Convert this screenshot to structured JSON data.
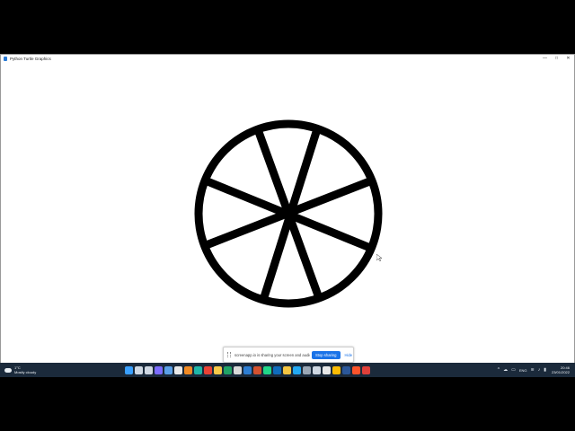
{
  "window": {
    "title": "Python Turtle Graphics",
    "controls": {
      "minimize": "—",
      "maximize": "□",
      "close": "✕"
    }
  },
  "drawing": {
    "description_shape": "circle with 4 thick spokes through center",
    "stroke_color": "#000000",
    "background": "#ffffff"
  },
  "share_bar": {
    "message": "screenapp.io is sharing your screen and audio.",
    "stop_label": "Stop sharing",
    "hide_label": "Hide"
  },
  "taskbar": {
    "weather": {
      "temp": "1°C",
      "condition": "Mostly cloudy",
      "icon": "cloud-icon"
    },
    "apps": [
      {
        "name": "windows-start-icon",
        "color": "#3aa0ff"
      },
      {
        "name": "search-icon",
        "color": "#cfd8e3"
      },
      {
        "name": "task-view-icon",
        "color": "#cfd8e3"
      },
      {
        "name": "chat-icon",
        "color": "#7b6cff"
      },
      {
        "name": "widgets-icon",
        "color": "#5aa0e8"
      },
      {
        "name": "file-icon",
        "color": "#e8e8e8"
      },
      {
        "name": "sublime-icon",
        "color": "#f08a24"
      },
      {
        "name": "edge-icon",
        "color": "#1fb6a8"
      },
      {
        "name": "chrome-icon",
        "color": "#e94235"
      },
      {
        "name": "notes-icon",
        "color": "#f7c948"
      },
      {
        "name": "excel-icon",
        "color": "#21a366"
      },
      {
        "name": "app-icon",
        "color": "#d9d9d9"
      },
      {
        "name": "calc-icon",
        "color": "#2d7dd2"
      },
      {
        "name": "powerpoint-icon",
        "color": "#d35230"
      },
      {
        "name": "pycharm-icon",
        "color": "#21d789"
      },
      {
        "name": "outlook-icon",
        "color": "#0f6cbd"
      },
      {
        "name": "folder-icon",
        "color": "#f4c542"
      },
      {
        "name": "vscode-icon",
        "color": "#23a9f2"
      },
      {
        "name": "settings-icon",
        "color": "#9aa7b5"
      },
      {
        "name": "terminal-icon",
        "color": "#cfd8e3"
      },
      {
        "name": "calendar-icon",
        "color": "#e8e8e8"
      },
      {
        "name": "chrome-icon-2",
        "color": "#fbbc05"
      },
      {
        "name": "word-icon",
        "color": "#2b579a"
      },
      {
        "name": "brave-icon",
        "color": "#fb542b"
      },
      {
        "name": "recorder-icon",
        "color": "#e0403a"
      }
    ],
    "tray": {
      "chevron": "^",
      "lang": "ENG",
      "time": "20:46",
      "date": "23/01/2022"
    }
  }
}
